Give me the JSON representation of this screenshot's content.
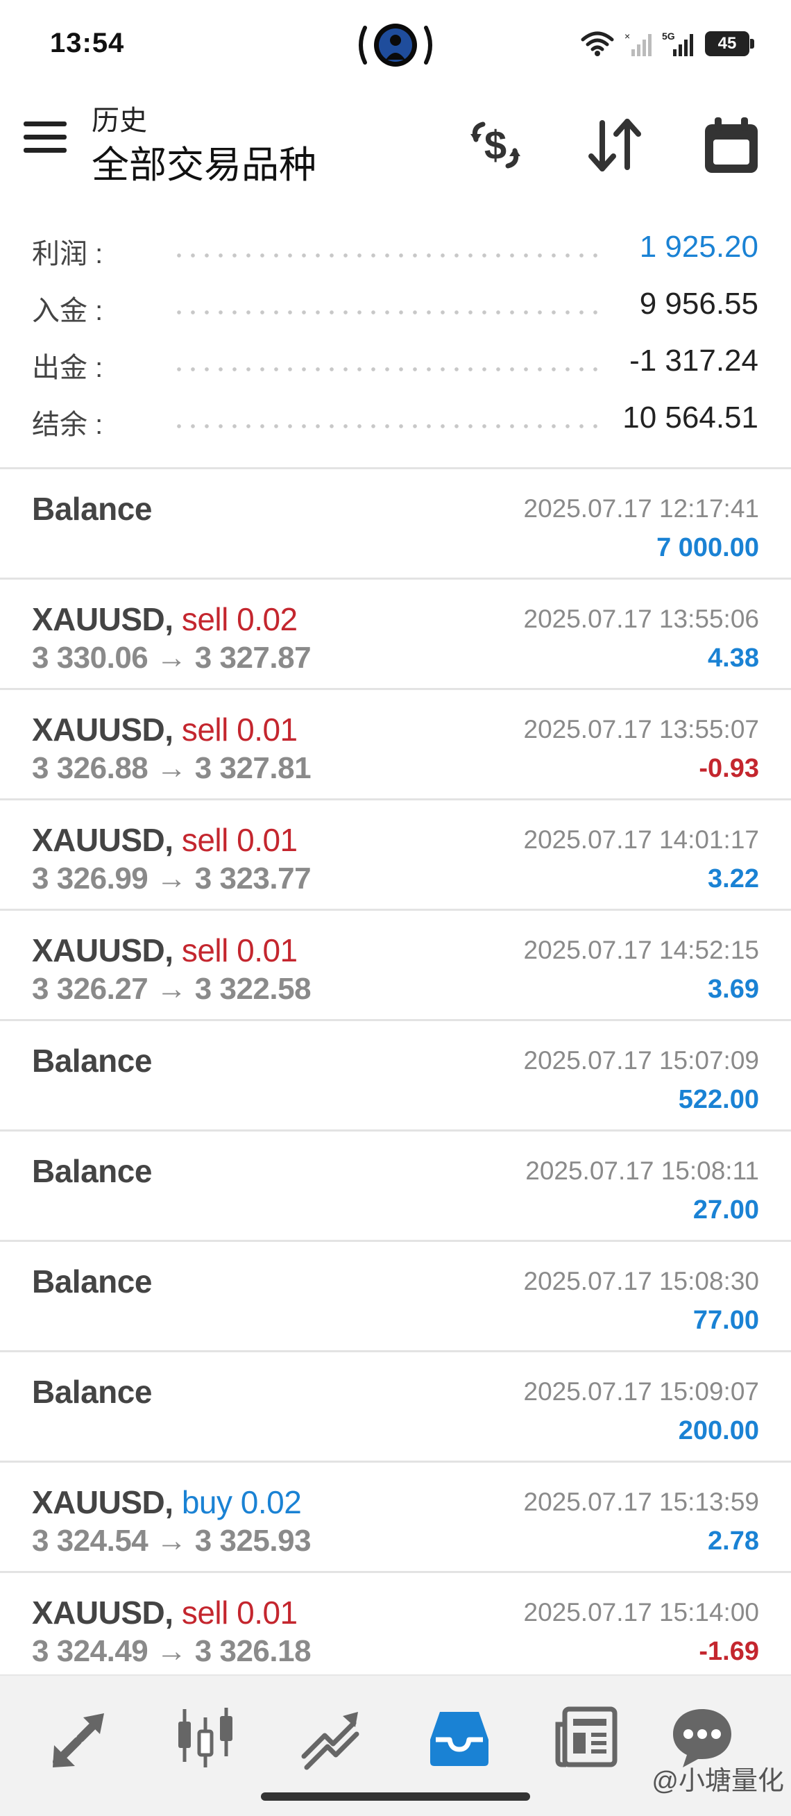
{
  "status": {
    "time": "13:54",
    "battery": "45"
  },
  "header": {
    "subtitle": "历史",
    "title": "全部交易品种"
  },
  "summary": [
    {
      "label": "利润 :",
      "value": "1 925.20",
      "highlight": true
    },
    {
      "label": "入金 :",
      "value": "9 956.55",
      "highlight": false
    },
    {
      "label": "出金 :",
      "value": "-1 317.24",
      "highlight": false
    },
    {
      "label": "结余 :",
      "value": "10 564.51",
      "highlight": false
    }
  ],
  "deals": [
    {
      "kind": "balance",
      "symbol": "Balance",
      "time": "2025.07.17 12:17:41",
      "profit": "7 000.00",
      "sign": "pos"
    },
    {
      "kind": "trade",
      "symbol": "XAUUSD",
      "sep": ",",
      "direction": "sell 0.02",
      "dir": "sell",
      "open": "3 330.06",
      "arrow": "→",
      "close": "3 327.87",
      "time": "2025.07.17 13:55:06",
      "profit": "4.38",
      "sign": "pos"
    },
    {
      "kind": "trade",
      "symbol": "XAUUSD",
      "sep": ",",
      "direction": "sell 0.01",
      "dir": "sell",
      "open": "3 326.88",
      "arrow": "→",
      "close": "3 327.81",
      "time": "2025.07.17 13:55:07",
      "profit": "-0.93",
      "sign": "neg"
    },
    {
      "kind": "trade",
      "symbol": "XAUUSD",
      "sep": ",",
      "direction": "sell 0.01",
      "dir": "sell",
      "open": "3 326.99",
      "arrow": "→",
      "close": "3 323.77",
      "time": "2025.07.17 14:01:17",
      "profit": "3.22",
      "sign": "pos"
    },
    {
      "kind": "trade",
      "symbol": "XAUUSD",
      "sep": ",",
      "direction": "sell 0.01",
      "dir": "sell",
      "open": "3 326.27",
      "arrow": "→",
      "close": "3 322.58",
      "time": "2025.07.17 14:52:15",
      "profit": "3.69",
      "sign": "pos"
    },
    {
      "kind": "balance",
      "symbol": "Balance",
      "time": "2025.07.17 15:07:09",
      "profit": "522.00",
      "sign": "pos"
    },
    {
      "kind": "balance",
      "symbol": "Balance",
      "time": "2025.07.17 15:08:11",
      "profit": "27.00",
      "sign": "pos"
    },
    {
      "kind": "balance",
      "symbol": "Balance",
      "time": "2025.07.17 15:08:30",
      "profit": "77.00",
      "sign": "pos"
    },
    {
      "kind": "balance",
      "symbol": "Balance",
      "time": "2025.07.17 15:09:07",
      "profit": "200.00",
      "sign": "pos"
    },
    {
      "kind": "trade",
      "symbol": "XAUUSD",
      "sep": ",",
      "direction": "buy 0.02",
      "dir": "buy",
      "open": "3 324.54",
      "arrow": "→",
      "close": "3 325.93",
      "time": "2025.07.17 15:13:59",
      "profit": "2.78",
      "sign": "pos"
    },
    {
      "kind": "trade",
      "symbol": "XAUUSD",
      "sep": ",",
      "direction": "sell 0.01",
      "dir": "sell",
      "open": "3 324.49",
      "arrow": "→",
      "close": "3 326.18",
      "time": "2025.07.17 15:14:00",
      "profit": "-1.69",
      "sign": "neg"
    }
  ],
  "nav": {
    "items": [
      "quotes-icon",
      "chart-icon",
      "trade-icon",
      "history-icon",
      "news-icon",
      "chat-icon"
    ],
    "active": "history-icon",
    "watermark": "@小塘量化"
  },
  "colors": {
    "accent": "#1a82d4",
    "sell": "#c4262e",
    "buy": "#1a82d4",
    "muted": "#8a8a8a"
  }
}
